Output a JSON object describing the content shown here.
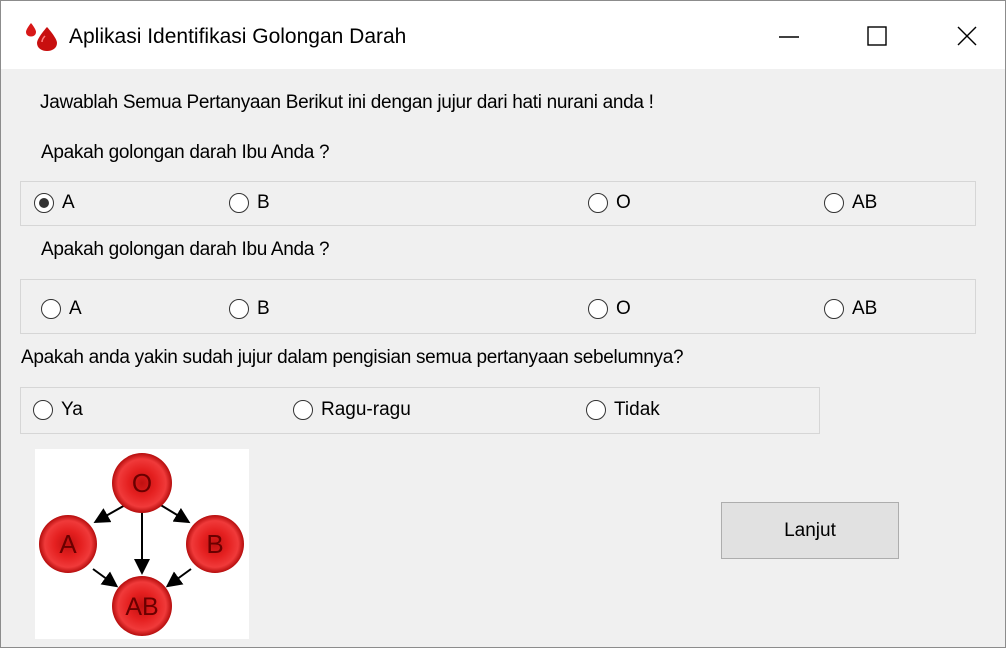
{
  "window": {
    "title": "Aplikasi Identifikasi Golongan Darah",
    "icon": "blood-drop-icon",
    "controls": [
      "minimize-icon",
      "maximize-icon",
      "close-icon"
    ]
  },
  "instruction": "Jawablah Semua Pertanyaan Berikut ini dengan jujur dari hati nurani anda !",
  "question1": {
    "label": "Apakah golongan darah Ibu Anda ?",
    "options": [
      "A",
      "B",
      "O",
      "AB"
    ],
    "selected": "A"
  },
  "question2": {
    "label": "Apakah golongan darah Ibu Anda ?",
    "options": [
      "A",
      "B",
      "O",
      "AB"
    ],
    "selected": null
  },
  "question3": {
    "label": "Apakah anda yakin sudah jujur dalam pengisian semua pertanyaan sebelumnya?",
    "options": [
      "Ya",
      "Ragu-ragu",
      "Tidak"
    ],
    "selected": null
  },
  "diagram": {
    "cells": [
      "O",
      "A",
      "B",
      "AB"
    ],
    "color": "#e01818"
  },
  "next_button": "Lanjut"
}
